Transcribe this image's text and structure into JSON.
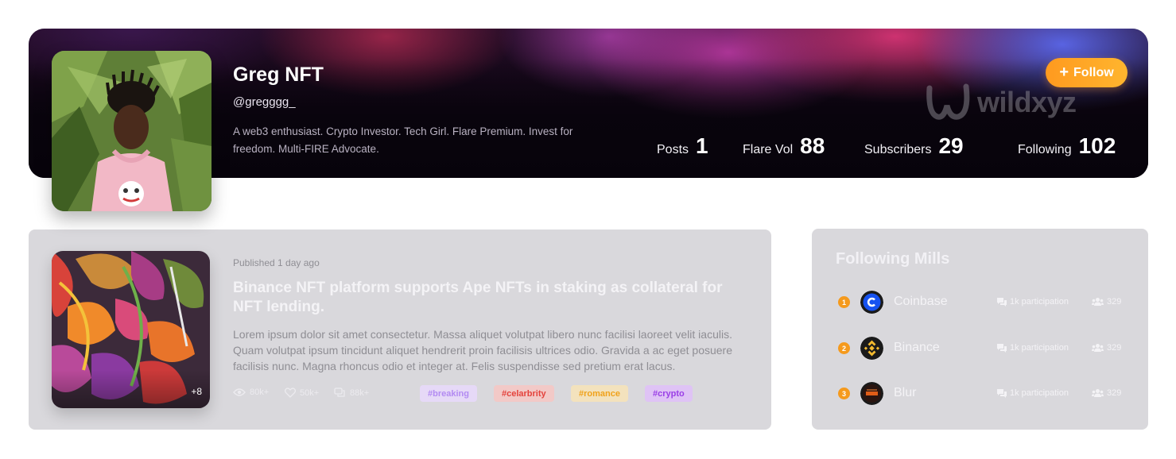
{
  "profile": {
    "name": "Greg NFT",
    "handle": "@gregggg_",
    "bio": "A web3 enthusiast. Crypto Investor. Tech Girl. Flare Premium. Invest for freedom. Multi-FIRE Advocate.",
    "follow_label": "Follow",
    "watermark": "wildxyz",
    "stats": [
      {
        "label": "Posts",
        "value": "1"
      },
      {
        "label": "Flare Vol",
        "value": "88"
      },
      {
        "label": "Subscribers",
        "value": "29"
      },
      {
        "label": "Following",
        "value": "102"
      }
    ]
  },
  "post": {
    "published": "Published 1 day ago",
    "title": "Binance NFT platform supports Ape NFTs in staking as collateral for NFT lending.",
    "body": "Lorem ipsum dolor sit amet consectetur. Massa aliquet volutpat libero nunc facilisi laoreet velit iaculis. Quam volutpat ipsum tincidunt aliquet hendrerit proin facilisis ultrices odio. Gravida a ac eget posuere facilisis nunc. Magna rhoncus odio et integer at. Felis suspendisse sed pretium erat lacus.",
    "thumb_more": "+8",
    "metrics": {
      "views": "80k+",
      "likes": "50k+",
      "comments": "88k+"
    },
    "tags": [
      {
        "label": "#breaking",
        "color": "#b38bf2",
        "bg": "#e6d9f7"
      },
      {
        "label": "#celarbrity",
        "color": "#e4423c",
        "bg": "#f2c9c7"
      },
      {
        "label": "#romance",
        "color": "#f0a21b",
        "bg": "#f3e2bd"
      },
      {
        "label": "#crypto",
        "color": "#9a3ee6",
        "bg": "#dfc3f5"
      }
    ]
  },
  "following_mills": {
    "title": "Following Mills",
    "items": [
      {
        "rank": "1",
        "name": "Coinbase",
        "participation": "1k participation",
        "members": "329"
      },
      {
        "rank": "2",
        "name": "Binance",
        "participation": "1k participation",
        "members": "329"
      },
      {
        "rank": "3",
        "name": "Blur",
        "participation": "1k participation",
        "members": "329"
      }
    ]
  },
  "colors": {
    "accent": "#ff9f22",
    "card_bg": "#d9d8dc"
  }
}
